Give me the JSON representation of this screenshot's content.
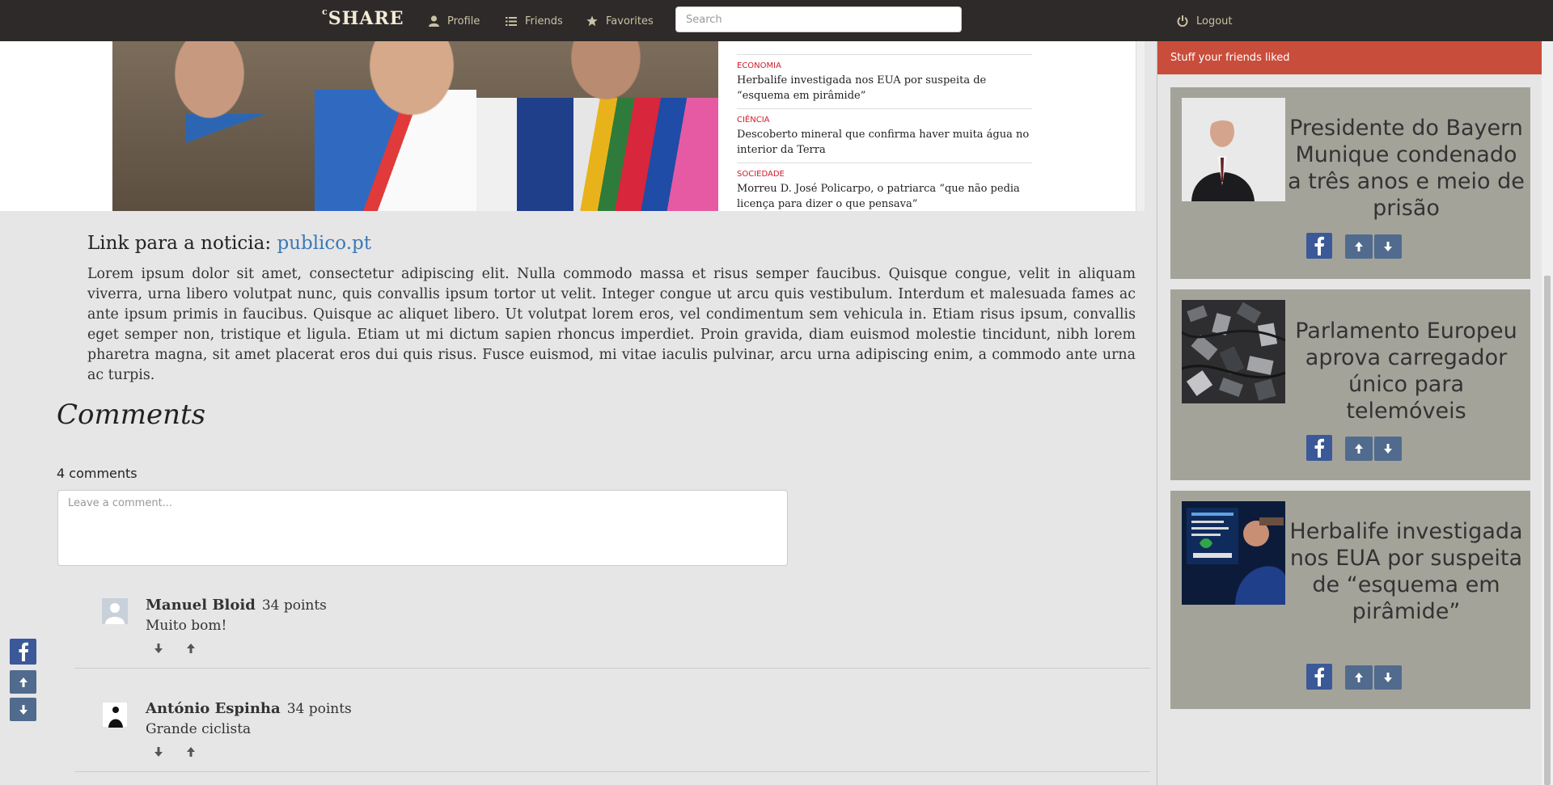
{
  "navbar": {
    "brand_sup": "c",
    "brand": "SHARE",
    "profile_label": "Profile",
    "friends_label": "Friends",
    "favorites_label": "Favorites",
    "search_placeholder": "Search",
    "logout_label": "Logout"
  },
  "article_preview": {
    "news": [
      {
        "category": "ECONOMIA",
        "title": "Herbalife investigada nos EUA por suspeita de “esquema em pirâmide”"
      },
      {
        "category": "CIÊNCIA",
        "title": "Descoberto mineral que confirma haver muita água no interior da Terra"
      },
      {
        "category": "SOCIEDADE",
        "title": "Morreu D. José Policarpo, o patriarca “que não pedia licença para dizer o que pensava”"
      }
    ]
  },
  "article": {
    "link_prefix": "Link para a noticia: ",
    "link_text": "publico.pt",
    "body": "Lorem ipsum dolor sit amet, consectetur adipiscing elit. Nulla commodo massa et risus semper faucibus. Quisque congue, velit in aliquam viverra, urna libero volutpat nunc, quis convallis ipsum tortor ut velit. Integer congue ut arcu quis vestibulum. Interdum et malesuada fames ac ante ipsum primis in faucibus. Quisque ac aliquet libero. Ut volutpat lorem eros, vel condimentum sem vehicula in. Etiam risus ipsum, convallis eget semper non, tristique et ligula. Etiam ut mi dictum sapien rhoncus imperdiet. Proin gravida, diam euismod molestie tincidunt, nibh lorem pharetra magna, sit amet placerat eros dui quis risus. Fusce euismod, mi vitae iaculis pulvinar, arcu urna adipiscing enim, a commodo ante urna ac turpis."
  },
  "comments": {
    "heading": "Comments",
    "count_label": "4 comments",
    "input_placeholder": "Leave a comment...",
    "items": [
      {
        "author": "Manuel Bloid",
        "points": "34 points",
        "text": "Muito bom!"
      },
      {
        "author": "António Espinha",
        "points": "34 points",
        "text": "Grande ciclista"
      }
    ]
  },
  "sidebar": {
    "header": "Stuff your friends liked",
    "cards": [
      {
        "title": "Presidente do Bayern Munique condenado a três anos e meio de prisão"
      },
      {
        "title": "Parlamento Europeu aprova carregador único para telemóveis"
      },
      {
        "title": "Herbalife investigada nos EUA por suspeita de “esquema em pirâmide”"
      }
    ]
  },
  "colors": {
    "navbar_bg": "#2d2a29",
    "sidebar_header": "#c94d3b",
    "card_bg": "#a4a39a",
    "facebook": "#3b5998",
    "vote_button": "#506b8d",
    "link": "#3b79b8"
  },
  "icons": [
    "user-icon",
    "list-icon",
    "star-icon",
    "power-icon",
    "facebook-icon",
    "arrow-up-icon",
    "arrow-down-icon"
  ]
}
